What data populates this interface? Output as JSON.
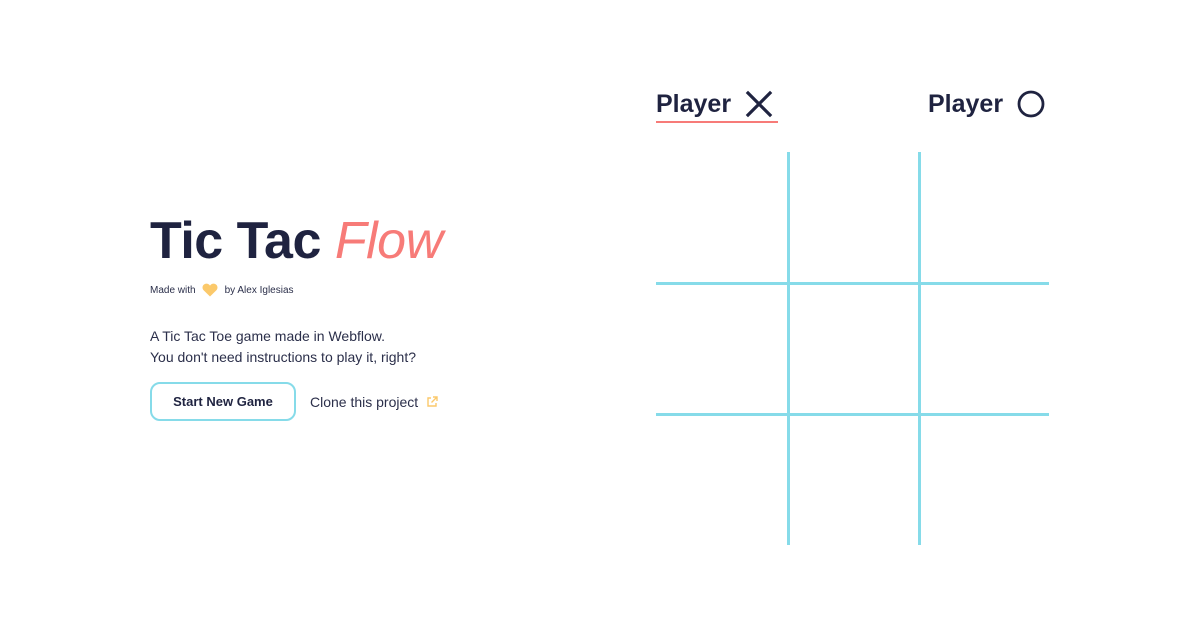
{
  "intro": {
    "title_main": "Tic Tac ",
    "title_accent": "Flow",
    "credit_prefix": "Made with",
    "credit_icon": "heart-icon",
    "credit_suffix": "by Alex Iglesias",
    "description_line1": "A Tic Tac Toe game made in Webflow.",
    "description_line2": "You don't need instructions to play it, right?",
    "start_button": "Start New Game",
    "clone_link": "Clone this project",
    "clone_icon": "external-link-icon"
  },
  "players": [
    {
      "label": "Player",
      "mark": "x-icon",
      "active": true
    },
    {
      "label": "Player",
      "mark": "circle-icon",
      "active": false
    }
  ],
  "board": {
    "rows": 3,
    "cols": 3,
    "cells": [
      "",
      "",
      "",
      "",
      "",
      "",
      "",
      "",
      ""
    ]
  },
  "colors": {
    "ink": "#1f2340",
    "accent": "#f77b78",
    "grid": "#86dbe9",
    "heart": "#fbc96b"
  }
}
